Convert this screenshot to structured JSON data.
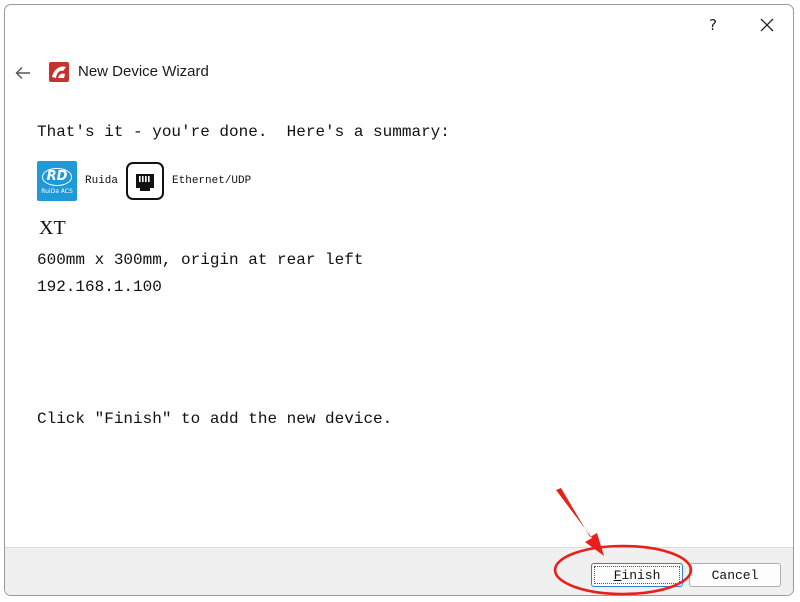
{
  "window": {
    "help_label": "?",
    "header_title": "New Device Wizard"
  },
  "summary": {
    "intro": "That's it - you're done.  Here's a summary:",
    "controller_label": "Ruida",
    "controller_logo_text": "RD",
    "controller_logo_subtext": "RuiDa ACS",
    "connection_label": "Ethernet/UDP",
    "device_name": "XT",
    "device_size": "600mm x 300mm, origin at rear left",
    "device_ip": "192.168.1.100",
    "finish_instruction": "Click \"Finish\" to add the new device."
  },
  "footer": {
    "finish_mnemonic": "F",
    "finish_rest": "inish",
    "cancel_label": "Cancel"
  },
  "colors": {
    "annotation_red": "#e8201a",
    "ruida_blue": "#1f9ad6",
    "app_icon_red": "#c8322c",
    "focus_blue": "#3a7bd5"
  }
}
